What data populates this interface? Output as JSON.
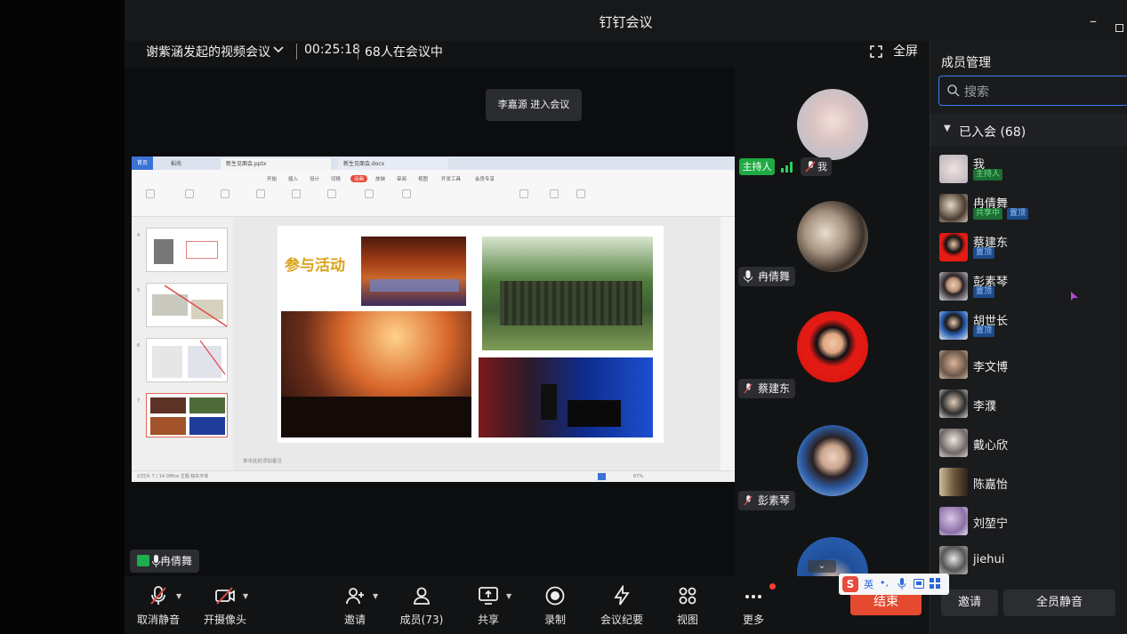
{
  "window": {
    "title": "钉钉会议"
  },
  "infobar": {
    "meeting_name": "谢紫涵发起的视频会议",
    "timer": "00:25:18",
    "participants_in_meeting": "68人在会议中",
    "fullscreen_label": "全屏"
  },
  "toast": "李嘉源 进入会议",
  "shared_screen": {
    "doc_tabs": [
      "首页",
      "稻壳",
      "新生见面会.pptx",
      "新生见面会.docx"
    ],
    "ribbon_menus": [
      "开始",
      "插入",
      "设计",
      "切换",
      "动画",
      "放映",
      "审阅",
      "视图",
      "开发工具",
      "会员专享"
    ],
    "active_menu": "动画",
    "slide_title": "参与活动",
    "notes_hint": "单击此处添加备注",
    "status_left": "幻灯片 7 / 14    Office 主题    缺失字体",
    "zoom": "67%",
    "thumb_numbers": [
      "4",
      "5",
      "6",
      "7"
    ]
  },
  "speaker": {
    "name": "冉倩舞"
  },
  "video_tiles": [
    {
      "name": "我",
      "host_badge": "主持人"
    },
    {
      "name": "冉倩舞"
    },
    {
      "name": "蔡建东"
    },
    {
      "name": "彭素琴"
    }
  ],
  "sidebar": {
    "title": "成员管理",
    "search_placeholder": "搜索",
    "section_label": "已入会 (68)",
    "members": [
      {
        "name": "我",
        "badges": [
          "主持人"
        ]
      },
      {
        "name": "冉倩舞",
        "badges": [
          "共享中",
          "置顶"
        ]
      },
      {
        "name": "蔡建东",
        "badges": [
          "置顶"
        ]
      },
      {
        "name": "彭素琴",
        "badges": [
          "置顶"
        ]
      },
      {
        "name": "胡世长",
        "badges": [
          "置顶"
        ]
      },
      {
        "name": "李文博",
        "badges": []
      },
      {
        "name": "李濮",
        "badges": []
      },
      {
        "name": "戴心欣",
        "badges": []
      },
      {
        "name": "陈嘉怡",
        "badges": []
      },
      {
        "name": "刘堃宁",
        "badges": []
      },
      {
        "name": "jiehui",
        "badges": []
      }
    ],
    "invite_label": "邀请",
    "mute_all_label": "全员静音",
    "ime": {
      "s": "S",
      "lang": "英"
    }
  },
  "toolbar": {
    "unmute": "取消静音",
    "camera": "开摄像头",
    "invite": "邀请",
    "members": "成员(73)",
    "share": "共享",
    "record": "录制",
    "minutes": "会议纪要",
    "view": "视图",
    "more": "更多",
    "end": "结束"
  },
  "colors": {
    "accent_blue": "#3d7cf5",
    "end_red": "#e5492f",
    "host_green": "#1faa43",
    "slide_title_gold": "#d9a21a"
  }
}
